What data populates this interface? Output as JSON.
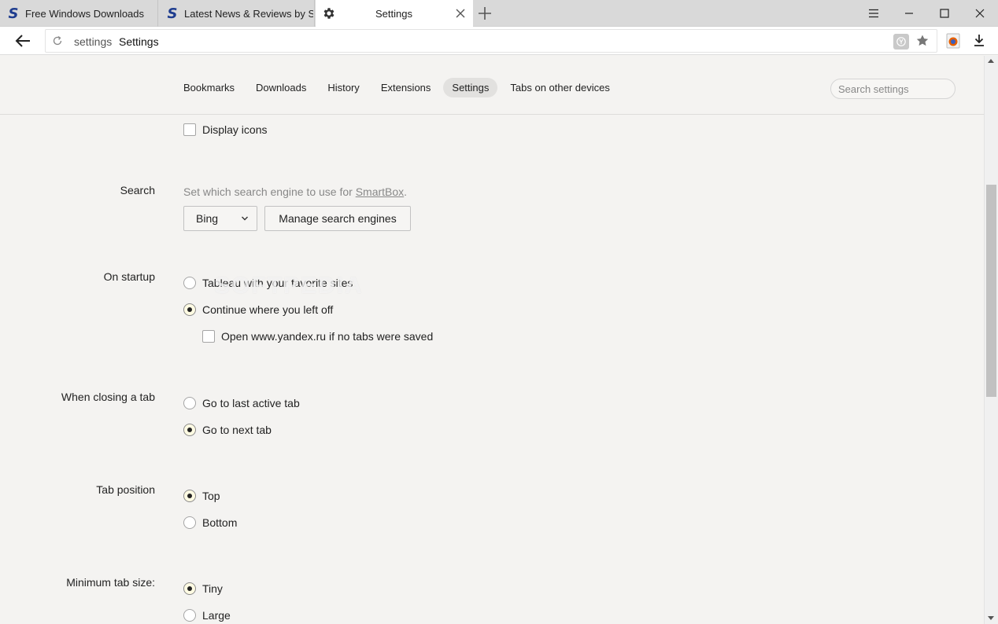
{
  "tabs": [
    {
      "title": "Free Windows Downloads",
      "icon": "softpedia-s-icon"
    },
    {
      "title": "Latest News & Reviews by So",
      "icon": "softpedia-s-icon"
    },
    {
      "title": "Settings",
      "icon": "gear-icon",
      "active": true
    }
  ],
  "address": {
    "host": "settings",
    "title": "Settings"
  },
  "nav": {
    "items": [
      "Bookmarks",
      "Downloads",
      "History",
      "Extensions",
      "Settings",
      "Tabs on other devices"
    ],
    "active": "Settings"
  },
  "search": {
    "placeholder": "Search settings"
  },
  "sections": {
    "display_icons": {
      "label": "Display icons",
      "checked": false
    },
    "search": {
      "heading": "Search",
      "hint_text": "Set which search engine to use for ",
      "hint_link": "SmartBox",
      "hint_end": ".",
      "engine": "Bing",
      "manage_label": "Manage search engines"
    },
    "startup": {
      "heading": "On startup",
      "option1": "Tableau with your favorite sites",
      "option2": "Continue where you left off",
      "sub_option": "Open www.yandex.ru if no tabs were saved",
      "selected": "Continue where you left off"
    },
    "closing": {
      "heading": "When closing a tab",
      "option1": "Go to last active tab",
      "option2": "Go to next tab",
      "selected": "Go to next tab"
    },
    "tab_position": {
      "heading": "Tab position",
      "option1": "Top",
      "option2": "Bottom",
      "selected": "Top"
    },
    "min_tab_size": {
      "heading": "Minimum tab size:",
      "option1": "Tiny",
      "option2": "Large",
      "selected": "Tiny"
    }
  },
  "watermark": "SOFTPEDIA",
  "colors": {
    "accent_brand": "#1f3d8f",
    "background": "#f4f3f1",
    "radio_selected_fill": "#fffbe3"
  }
}
